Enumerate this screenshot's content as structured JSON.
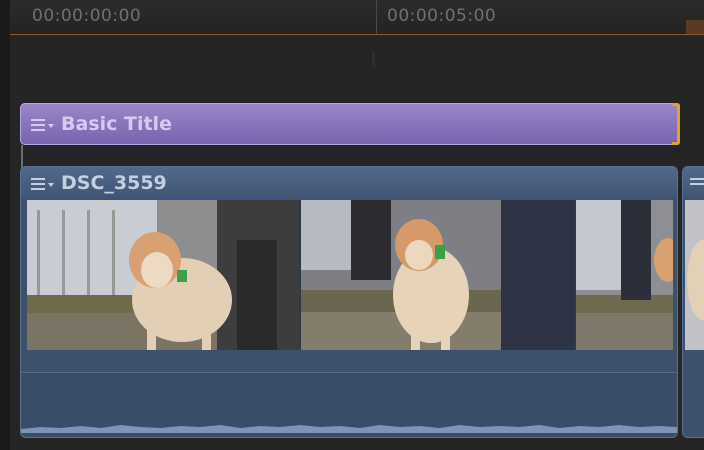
{
  "ruler": {
    "timecode_start": "00:00:00:00",
    "timecode_mid": "00:00:05:00"
  },
  "title_clip": {
    "label": "Basic Title",
    "icon": "clip-menu-icon",
    "color": "#8a76be",
    "selection_color": "#e0a22a"
  },
  "video_clip": {
    "label": "DSC_3559",
    "icon": "clip-menu-icon",
    "color": "#3e516c"
  },
  "next_clip": {
    "icon": "clip-menu-icon"
  }
}
